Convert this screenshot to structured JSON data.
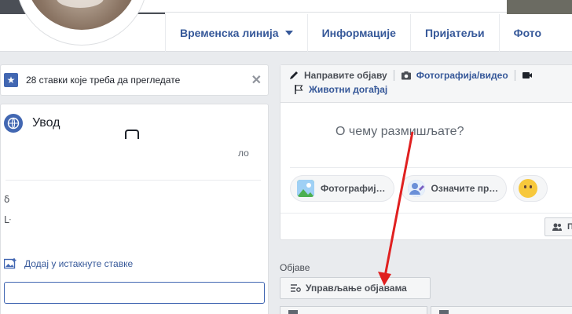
{
  "profile_nav": {
    "tabs": [
      {
        "label": "Временска линија",
        "has_caret": true
      },
      {
        "label": "Информације"
      },
      {
        "label": "Пријатељи"
      },
      {
        "label": "Фото"
      }
    ]
  },
  "left": {
    "review_banner": {
      "text": "28 ставки које треба да прегледате"
    },
    "intro": {
      "title": "Увод",
      "fragment_right": "ло",
      "fragment_a": "ẟ",
      "fragment_b": "ᒷ",
      "add_featured": "Додај у истакнуте ставке"
    }
  },
  "composer": {
    "actions_row1": [
      {
        "label": "Направите објаву",
        "icon": "pencil-icon"
      },
      {
        "label": "Фотографија/видео",
        "icon": "camera-icon"
      },
      {
        "label": "",
        "icon": "video-icon"
      }
    ],
    "actions_row2": [
      {
        "label": "Животни догађај",
        "icon": "flag-icon"
      }
    ],
    "placeholder": "О чему размишљате?",
    "chips": [
      {
        "label": "Фотографиј…",
        "icon": "photo-icon"
      },
      {
        "label": "Означите пр…",
        "icon": "tag-friends-icon"
      },
      {
        "label": "",
        "icon": "emoji-icon"
      }
    ],
    "audience_label": "П"
  },
  "posts": {
    "title": "Објаве",
    "manage_label": "Управљање објавама"
  },
  "colors": {
    "accent": "#4267b2",
    "link": "#365899",
    "annotation_arrow": "#e02020"
  }
}
